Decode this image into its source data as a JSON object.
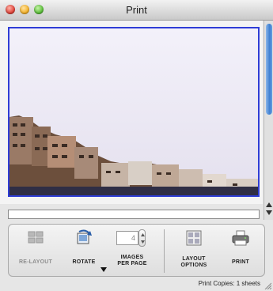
{
  "window": {
    "title": "Print"
  },
  "toolbar": {
    "relayout_label": "RE-LAYOUT",
    "rotate_label": "ROTATE",
    "images_per_page_label_line1": "IMAGES",
    "images_per_page_label_line2": "PER PAGE",
    "images_per_page_value": "4",
    "layout_options_label_line1": "LAYOUT",
    "layout_options_label_line2": "OPTIONS",
    "print_label": "PRINT"
  },
  "status": {
    "text": "Print Copies: 1 sheets"
  },
  "colors": {
    "selection_border": "#2f3dd6",
    "scroll_accent": "#3d7fd1"
  },
  "icons": [
    "relayout-icon",
    "rotate-icon",
    "layout-options-icon",
    "printer-icon",
    "chevron-down-icon"
  ]
}
